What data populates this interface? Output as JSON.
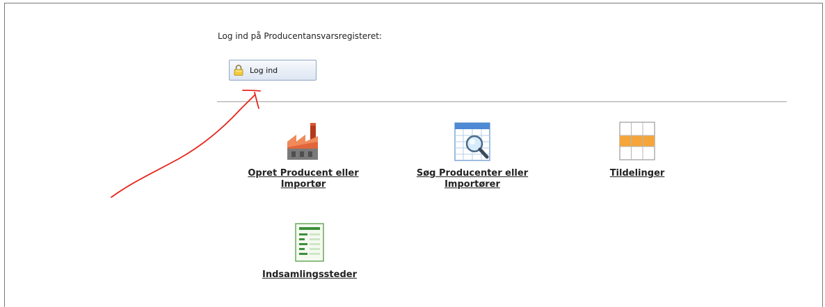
{
  "login": {
    "prompt": "Log ind på Producentansvarsregisteret:",
    "button_label": "Log ind",
    "button_icon": "lock-icon"
  },
  "tiles": [
    {
      "label_line1": "Opret Producent eller",
      "label_line2": "Importør",
      "icon": "factory-icon"
    },
    {
      "label_line1": "Søg Producenter eller",
      "label_line2": "Importører",
      "icon": "search-table-icon"
    },
    {
      "label_line1": "Tildelinger",
      "label_line2": "",
      "icon": "grid-icon"
    },
    {
      "label_line1": "Indsamlingssteder",
      "label_line2": "",
      "icon": "list-document-icon"
    }
  ],
  "annotation": {
    "color": "#e8241a",
    "icon": "red-arrow-annotation"
  }
}
